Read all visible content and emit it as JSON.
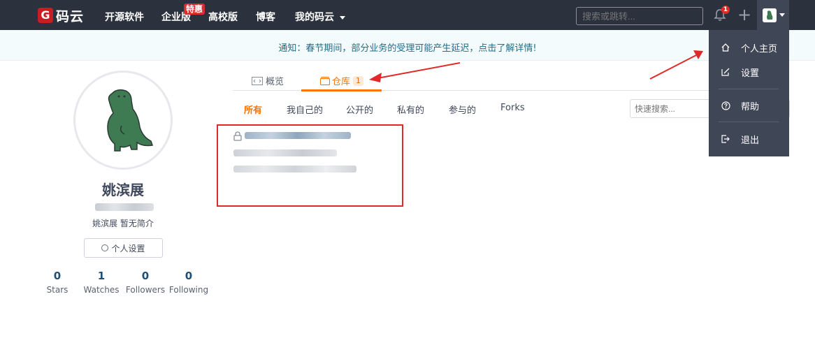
{
  "nav": {
    "logo_text": "码云",
    "links": [
      "开源软件",
      "企业版",
      "高校版",
      "博客"
    ],
    "hot_badge": "特惠",
    "my_gitee": "我的码云",
    "search_placeholder": "搜索或跳转...",
    "notification_count": "1",
    "icons": [
      "bell-icon",
      "plus-icon",
      "avatar",
      "chevron-down-icon"
    ]
  },
  "notice": {
    "text": "通知：春节期间，部分业务的受理可能产生延迟，点击了解详情!"
  },
  "profile": {
    "name": "姚滨展",
    "bio": "姚滨展 暂无简介",
    "settings_label": "个人设置",
    "stats": [
      {
        "value": "0",
        "label": "Stars"
      },
      {
        "value": "1",
        "label": "Watches"
      },
      {
        "value": "0",
        "label": "Followers"
      },
      {
        "value": "0",
        "label": "Following"
      }
    ]
  },
  "tabs": {
    "overview_label": "概览",
    "repos_label": "仓库",
    "repos_count": "1"
  },
  "filters": [
    "所有",
    "我自己的",
    "公开的",
    "私有的",
    "参与的",
    "Forks"
  ],
  "quick_search_placeholder": "快速搜索...",
  "dropdown": {
    "items": [
      {
        "label": "个人主页",
        "icon": "home-icon"
      },
      {
        "label": "设置",
        "icon": "edit-icon"
      },
      {
        "label": "帮助",
        "icon": "help-icon"
      },
      {
        "label": "退出",
        "icon": "logout-icon"
      }
    ]
  },
  "colors": {
    "nav_bg": "#2b313d",
    "accent": "#fe7300",
    "annotation_red": "#e02a2a",
    "dropdown_bg": "#3f4656"
  }
}
